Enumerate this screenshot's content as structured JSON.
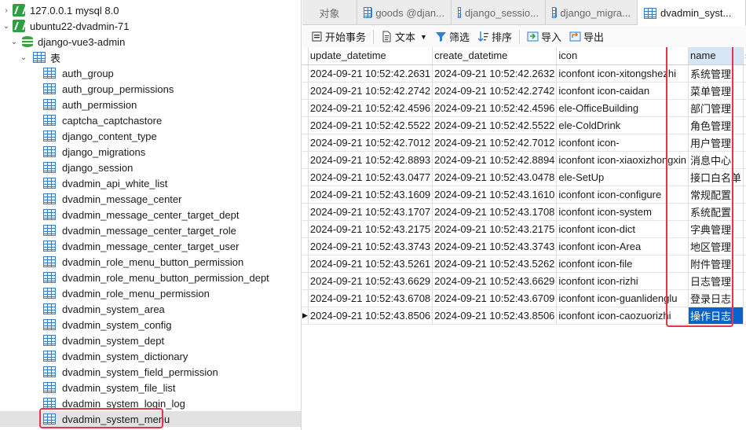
{
  "tree": {
    "connections": [
      {
        "label": "127.0.0.1 mysql 8.0",
        "expanded": false
      },
      {
        "label": "ubuntu22-dvadmin-71",
        "expanded": true
      }
    ],
    "database": {
      "label": "django-vue3-admin",
      "expanded": true
    },
    "tables_folder": {
      "label": "表",
      "expanded": true
    },
    "tables": [
      "auth_group",
      "auth_group_permissions",
      "auth_permission",
      "captcha_captchastore",
      "django_content_type",
      "django_migrations",
      "django_session",
      "dvadmin_api_white_list",
      "dvadmin_message_center",
      "dvadmin_message_center_target_dept",
      "dvadmin_message_center_target_role",
      "dvadmin_message_center_target_user",
      "dvadmin_role_menu_button_permission",
      "dvadmin_role_menu_button_permission_dept",
      "dvadmin_role_menu_permission",
      "dvadmin_system_area",
      "dvadmin_system_config",
      "dvadmin_system_dept",
      "dvadmin_system_dictionary",
      "dvadmin_system_field_permission",
      "dvadmin_system_file_list",
      "dvadmin_system_login_log",
      "dvadmin_system_menu"
    ],
    "selected_table": "dvadmin_system_menu"
  },
  "tabs": [
    {
      "label": "对象",
      "icon": "none",
      "active": false
    },
    {
      "label": "goods @djan...",
      "icon": "table-icon",
      "active": false
    },
    {
      "label": "django_sessio...",
      "icon": "table-icon",
      "active": false
    },
    {
      "label": "django_migra...",
      "icon": "table-icon",
      "active": false
    },
    {
      "label": "dvadmin_syst...",
      "icon": "table-icon",
      "active": true
    }
  ],
  "toolbar": {
    "begin_transaction": "开始事务",
    "text": "文本",
    "filter": "筛选",
    "sort": "排序",
    "import": "导入",
    "export": "导出"
  },
  "grid": {
    "columns": [
      "update_datetime",
      "create_datetime",
      "icon",
      "name",
      "s"
    ],
    "selected_column": "name",
    "current_row_index": 14,
    "rows": [
      [
        "2024-09-21 10:52:42.2631",
        "2024-09-21 10:52:42.2632",
        "iconfont icon-xitongshezhi",
        "系统管理"
      ],
      [
        "2024-09-21 10:52:42.2742",
        "2024-09-21 10:52:42.2742",
        "iconfont icon-caidan",
        "菜单管理"
      ],
      [
        "2024-09-21 10:52:42.4596",
        "2024-09-21 10:52:42.4596",
        "ele-OfficeBuilding",
        "部门管理"
      ],
      [
        "2024-09-21 10:52:42.5522",
        "2024-09-21 10:52:42.5522",
        "ele-ColdDrink",
        "角色管理"
      ],
      [
        "2024-09-21 10:52:42.7012",
        "2024-09-21 10:52:42.7012",
        "iconfont icon-",
        "用户管理"
      ],
      [
        "2024-09-21 10:52:42.8893",
        "2024-09-21 10:52:42.8894",
        "iconfont icon-xiaoxizhongxin",
        "消息中心"
      ],
      [
        "2024-09-21 10:52:43.0477",
        "2024-09-21 10:52:43.0478",
        "ele-SetUp",
        "接口白名单"
      ],
      [
        "2024-09-21 10:52:43.1609",
        "2024-09-21 10:52:43.1610",
        "iconfont icon-configure",
        "常规配置"
      ],
      [
        "2024-09-21 10:52:43.1707",
        "2024-09-21 10:52:43.1708",
        "iconfont icon-system",
        "系统配置"
      ],
      [
        "2024-09-21 10:52:43.2175",
        "2024-09-21 10:52:43.2175",
        "iconfont icon-dict",
        "字典管理"
      ],
      [
        "2024-09-21 10:52:43.3743",
        "2024-09-21 10:52:43.3743",
        "iconfont icon-Area",
        "地区管理"
      ],
      [
        "2024-09-21 10:52:43.5261",
        "2024-09-21 10:52:43.5262",
        "iconfont icon-file",
        "附件管理"
      ],
      [
        "2024-09-21 10:52:43.6629",
        "2024-09-21 10:52:43.6629",
        "iconfont icon-rizhi",
        "日志管理"
      ],
      [
        "2024-09-21 10:52:43.6708",
        "2024-09-21 10:52:43.6709",
        "iconfont icon-guanlidenglu",
        "登录日志"
      ],
      [
        "2024-09-21 10:52:43.8506",
        "2024-09-21 10:52:43.8506",
        "iconfont icon-caozuorizhi",
        "操作日志"
      ]
    ]
  },
  "colors": {
    "highlight_box": "#e8344a",
    "selected_cell": "#0a63c9",
    "selected_header": "#d7e6f7",
    "tree_table_icon": "#3b7dc4",
    "connection_icon": "#2f9e44"
  }
}
